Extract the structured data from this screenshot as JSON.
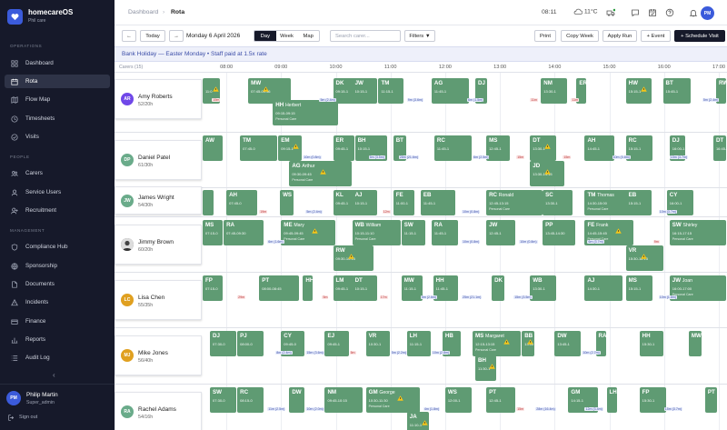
{
  "brand": {
    "title": "homecareOS",
    "subtitle": "Phil care"
  },
  "sidebar": {
    "sections": [
      "OPERATIONS",
      "PEOPLE",
      "MANAGEMENT"
    ],
    "items": [
      {
        "label": "Dashboard",
        "icon": "grid-icon"
      },
      {
        "label": "Rota",
        "icon": "calendar-icon",
        "active": true
      },
      {
        "label": "Flow Map",
        "icon": "map-icon"
      },
      {
        "label": "Timesheets",
        "icon": "clock-icon"
      },
      {
        "label": "Visits",
        "icon": "check-circle-icon"
      },
      {
        "label": "Carers",
        "icon": "users-icon"
      },
      {
        "label": "Service Users",
        "icon": "user-icon"
      },
      {
        "label": "Recruitment",
        "icon": "user-plus-icon"
      },
      {
        "label": "Compliance Hub",
        "icon": "shield-icon"
      },
      {
        "label": "Sponsorship",
        "icon": "globe-icon"
      },
      {
        "label": "Documents",
        "icon": "file-icon"
      },
      {
        "label": "Incidents",
        "icon": "alert-icon"
      },
      {
        "label": "Finance",
        "icon": "finance-icon"
      },
      {
        "label": "Reports",
        "icon": "bar-chart-icon"
      },
      {
        "label": "Audit Log",
        "icon": "list-icon"
      }
    ],
    "collapse": "‹",
    "user": {
      "initials": "PM",
      "name": "Philip Martin",
      "role": "Super_admin"
    },
    "signout": "Sign out"
  },
  "topbar": {
    "crumb1": "Dashboard",
    "sep": "›",
    "crumb2": "Rota",
    "time": "08:11",
    "weather": "11°C",
    "avatar": "PM"
  },
  "toolbar": {
    "prev": "←",
    "today": "Today",
    "next": "→",
    "date": "Monday 6 April 2026",
    "views": [
      "Day",
      "Week",
      "Map"
    ],
    "active_view": "Day",
    "search_placeholder": "Search carer...",
    "filters": "Filters ▼",
    "print": "Print",
    "copy_week": "Copy Week",
    "apply_run": "Apply Run",
    "add_event": "+ Event",
    "schedule": "+ Schedule Visit"
  },
  "banner": "Bank Holiday  —  Easter Monday  •  Staff paid at 1.5x rate",
  "grid": {
    "carers_label": "Carers (15)",
    "hours": [
      "08:00",
      "09:00",
      "10:00",
      "11:00",
      "12:00",
      "13:00",
      "14:00",
      "15:00",
      "16:00",
      "17:00"
    ],
    "start_hour": 7.55,
    "end_hour": 17.15
  },
  "carers": [
    {
      "name": "Amy Roberts",
      "hours": "52/20h",
      "initials": "AR",
      "color": "#7048e8",
      "shifts": [
        {
          "i": "",
          "s": 7.55,
          "e": 7.9,
          "w": 1,
          "t": "11:0"
        },
        {
          "i": "MW",
          "s": 8.4,
          "e": 9.2,
          "w": 1,
          "t": "07:45-09:36"
        },
        {
          "i": "DK",
          "s": 9.95,
          "e": 10.4,
          "t": "09:15-1"
        },
        {
          "i": "JW",
          "s": 10.3,
          "e": 10.78,
          "t": "10:15-1"
        },
        {
          "i": "TM",
          "s": 10.78,
          "e": 11.25,
          "t": "11:15-1"
        },
        {
          "i": "AG",
          "s": 11.75,
          "e": 12.45,
          "t": "11:45-1"
        },
        {
          "i": "DJ",
          "s": 12.55,
          "e": 12.78
        },
        {
          "i": "NM",
          "s": 13.75,
          "e": 14.25,
          "t": "13:30-1"
        },
        {
          "i": "ER",
          "s": 14.4,
          "e": 14.6
        },
        {
          "i": "HW",
          "s": 15.3,
          "e": 15.78,
          "w": 1,
          "t": "15:15-1"
        },
        {
          "i": "BT",
          "s": 15.98,
          "e": 16.5,
          "t": "15:45-1"
        },
        {
          "i": "RW",
          "s": 16.95,
          "e": 17.15
        },
        {
          "i": "HH",
          "n": "Herbert",
          "s": 8.85,
          "e": 10.05,
          "t": "09:15-09:15",
          "pc": "Personal Care",
          "l": 2
        }
      ],
      "gaps": [
        {
          "s": 7.74,
          "v": "19m",
          "c": "r"
        },
        {
          "s": 9.7,
          "v": "5m (2.4m)",
          "c": "b"
        },
        {
          "s": 11.3,
          "v": "9m (3.6m)",
          "c": "b"
        },
        {
          "s": 12.4,
          "v": "6m (1.5m)",
          "c": "b"
        },
        {
          "s": 13.55,
          "v": "11m",
          "c": "r"
        },
        {
          "s": 14.3,
          "v": "11m",
          "c": "r"
        },
        {
          "s": 16.7,
          "v": "5m (2.4m)",
          "c": "b"
        }
      ]
    },
    {
      "name": "Daniel Patel",
      "hours": "61/30h",
      "initials": "DP",
      "color": "#6aab8a",
      "shifts": [
        {
          "i": "AW",
          "s": 7.55,
          "e": 7.95
        },
        {
          "i": "TM",
          "s": 8.25,
          "e": 8.95,
          "t": "07:45-0"
        },
        {
          "i": "EM",
          "s": 8.95,
          "e": 9.4,
          "w": 1,
          "t": "09:15-1"
        },
        {
          "i": "ER",
          "s": 9.95,
          "e": 10.35,
          "t": "09:45-1"
        },
        {
          "i": "BH",
          "s": 10.35,
          "e": 10.95,
          "t": "10:15-1"
        },
        {
          "i": "BT",
          "s": 11.05,
          "e": 11.3
        },
        {
          "i": "RC",
          "s": 11.8,
          "e": 12.5,
          "t": "11:45-1"
        },
        {
          "i": "MS",
          "s": 12.75,
          "e": 13.2,
          "t": "12:45-1"
        },
        {
          "i": "DT",
          "s": 13.55,
          "e": 14.05,
          "w": 1,
          "t": "13:30-1"
        },
        {
          "i": "AH",
          "s": 14.55,
          "e": 15.1,
          "t": "14:45-1"
        },
        {
          "i": "RC",
          "s": 15.3,
          "e": 15.8,
          "t": "15:15-1"
        },
        {
          "i": "DJ",
          "s": 16.1,
          "e": 16.4,
          "t": "16:00-1"
        },
        {
          "i": "DT",
          "s": 16.9,
          "e": 17.15,
          "t": "16:45-1"
        },
        {
          "i": "AG",
          "n": "Arthur",
          "s": 9.15,
          "e": 10.3,
          "w": 1,
          "t": "09:30-09:45",
          "pc": "Personal Care",
          "l": 2
        },
        {
          "i": "JD",
          "s": 13.55,
          "e": 14.2,
          "w": 1,
          "t": "13:30-14:15",
          "l": 2
        }
      ],
      "gaps": [
        {
          "s": 9.4,
          "v": "10m (0.8m)",
          "c": "b"
        },
        {
          "s": 10.6,
          "v": "5m (3.5m)",
          "c": "b"
        },
        {
          "s": 11.15,
          "v": "28m (21.6m)",
          "c": "b"
        },
        {
          "s": 12.5,
          "v": "6m (2.5m)",
          "c": "b"
        },
        {
          "s": 13.3,
          "v": "15m",
          "c": "r"
        },
        {
          "s": 14.15,
          "v": "15m",
          "c": "r"
        },
        {
          "s": 15.05,
          "v": "10m (0.8m)",
          "c": "b"
        },
        {
          "s": 16.1,
          "v": "15m (3.7m)",
          "c": "b"
        }
      ]
    },
    {
      "name": "James Wright",
      "hours": "54/30h",
      "initials": "JW",
      "color": "#6aab8a",
      "shifts": [
        {
          "i": "",
          "s": 7.55,
          "e": 7.78
        },
        {
          "i": "AH",
          "s": 8.0,
          "e": 8.58,
          "t": "07:45-0"
        },
        {
          "i": "WS",
          "s": 8.98,
          "e": 9.25
        },
        {
          "i": "KL",
          "s": 9.95,
          "e": 10.4,
          "t": "09:45-1"
        },
        {
          "i": "AJ",
          "s": 10.3,
          "e": 10.78,
          "t": "10:15-1"
        },
        {
          "i": "FE",
          "s": 11.05,
          "e": 11.45,
          "t": "11:00-1"
        },
        {
          "i": "EB",
          "s": 11.55,
          "e": 12.2,
          "t": "11:45-1"
        },
        {
          "i": "RC",
          "n": "Ronald",
          "s": 12.75,
          "e": 13.8,
          "t": "12:45-13:15",
          "pc": "Personal Care"
        },
        {
          "i": "SC",
          "s": 13.78,
          "e": 14.35,
          "t": "13:30-1"
        },
        {
          "i": "TM",
          "n": "Thomas",
          "s": 14.55,
          "e": 15.4,
          "t": "14:30-15:00",
          "pc": "Personal Care"
        },
        {
          "i": "EB",
          "s": 15.3,
          "e": 15.78,
          "t": "15:15-1"
        },
        {
          "i": "CY",
          "s": 16.05,
          "e": 16.55,
          "t": "16:00-1"
        }
      ],
      "gaps": [
        {
          "s": 8.6,
          "v": "19m",
          "c": "r"
        },
        {
          "s": 9.45,
          "v": "5m (2.4m)",
          "c": "b"
        },
        {
          "s": 10.85,
          "v": "12m",
          "c": "r"
        },
        {
          "s": 12.3,
          "v": "10m (0.8m)",
          "c": "b"
        },
        {
          "s": 15.9,
          "v": "10m (3.7m)",
          "c": "b"
        }
      ]
    },
    {
      "name": "Jimmy Brown",
      "hours": "60/20h",
      "initials": "JB",
      "color": "#555",
      "photo": true,
      "shifts": [
        {
          "i": "MS",
          "s": 7.45,
          "e": 7.95,
          "t": "07:15-0"
        },
        {
          "i": "RA",
          "s": 7.95,
          "e": 8.7,
          "t": "07:45-09:30"
        },
        {
          "i": "ME",
          "n": "Mary",
          "s": 9.0,
          "e": 10.0,
          "w": 1,
          "t": "09:45-09:45",
          "pc": "Personal Care"
        },
        {
          "i": "WB",
          "n": "William",
          "s": 10.3,
          "e": 11.2,
          "t": "10:15-11:10",
          "pc": "Personal Care"
        },
        {
          "i": "SW",
          "s": 11.2,
          "e": 11.65,
          "t": "11:15-1"
        },
        {
          "i": "RA",
          "s": 11.75,
          "e": 12.25,
          "t": "11:45-1"
        },
        {
          "i": "JW",
          "s": 12.75,
          "e": 13.3,
          "t": "12:45-1"
        },
        {
          "i": "PP",
          "s": 13.78,
          "e": 14.4,
          "t": "13:45-14:30"
        },
        {
          "i": "FE",
          "n": "Frank",
          "s": 14.55,
          "e": 15.45,
          "w": 1,
          "t": "14:45-15:45",
          "pc": "Personal Care"
        },
        {
          "i": "SW",
          "n": "Shirley",
          "s": 16.1,
          "e": 17.15,
          "t": "16:15-17:15",
          "pc": "Personal Care"
        },
        {
          "i": "RW",
          "s": 9.95,
          "e": 10.7,
          "w": 1,
          "t": "09:30-10:15",
          "l": 2
        },
        {
          "i": "VR",
          "s": 15.3,
          "e": 16.0,
          "w": 1,
          "t": "15:30-16:15",
          "l": 2
        }
      ],
      "gaps": [
        {
          "s": 8.75,
          "v": "6m (1.6m)",
          "c": "b"
        },
        {
          "s": 12.3,
          "v": "10m (0.8m)",
          "c": "b"
        },
        {
          "s": 13.35,
          "v": "10m (0.8m)",
          "c": "b"
        },
        {
          "s": 14.6,
          "v": "6m (3.7m)",
          "c": "b"
        },
        {
          "s": 15.8,
          "v": "9m",
          "c": "r"
        }
      ]
    },
    {
      "name": "Lisa Chen",
      "hours": "55/35h",
      "initials": "LC",
      "color": "#e0a020",
      "shifts": [
        {
          "i": "FP",
          "s": 7.45,
          "e": 7.95,
          "t": "07:15-0"
        },
        {
          "i": "PT",
          "s": 8.6,
          "e": 9.35,
          "t": "08:00-08:45"
        },
        {
          "i": "HH",
          "s": 9.4,
          "e": 9.6
        },
        {
          "i": "LM",
          "s": 9.95,
          "e": 10.35,
          "t": "09:45-1"
        },
        {
          "i": "DT",
          "s": 10.3,
          "e": 10.78,
          "t": "10:15-1"
        },
        {
          "i": "MW",
          "s": 11.2,
          "e": 11.6,
          "t": "11:15-1"
        },
        {
          "i": "HH",
          "s": 11.78,
          "e": 12.25,
          "t": "11:45-1"
        },
        {
          "i": "DK",
          "s": 12.85,
          "e": 13.1
        },
        {
          "i": "WB",
          "s": 13.55,
          "e": 14.05,
          "t": "13:30-1"
        },
        {
          "i": "AJ",
          "s": 14.55,
          "e": 15.25,
          "t": "14:30-1"
        },
        {
          "i": "MS",
          "s": 15.3,
          "e": 15.8,
          "t": "15:15-1"
        },
        {
          "i": "JW",
          "n": "Joan",
          "s": 16.1,
          "e": 17.15,
          "t": "16:00-17:00",
          "pc": "Personal Care"
        }
      ],
      "gaps": [
        {
          "s": 8.2,
          "v": "29m",
          "c": "r"
        },
        {
          "s": 9.75,
          "v": "5m",
          "c": "r"
        },
        {
          "s": 10.8,
          "v": "17m",
          "c": "r"
        },
        {
          "s": 11.55,
          "v": "5m (2.6m)",
          "c": "b"
        },
        {
          "s": 12.3,
          "v": "25m (21.1m)",
          "c": "b"
        },
        {
          "s": 13.25,
          "v": "15m (3.5m)",
          "c": "b"
        },
        {
          "s": 15.9,
          "v": "10m (1.8m)",
          "c": "b"
        }
      ]
    },
    {
      "name": "Mike Jones",
      "hours": "56/40h",
      "initials": "MJ",
      "color": "#e0a020",
      "shifts": [
        {
          "i": "DJ",
          "s": 7.7,
          "e": 8.2,
          "t": "07:30-0"
        },
        {
          "i": "PJ",
          "s": 8.2,
          "e": 8.7,
          "t": "08:00-0"
        },
        {
          "i": "CY",
          "s": 9.0,
          "e": 9.45,
          "t": "09:45-0"
        },
        {
          "i": "EJ",
          "s": 9.8,
          "e": 10.25,
          "t": "09:45-1"
        },
        {
          "i": "VR",
          "s": 10.55,
          "e": 11.0,
          "t": "10:30-1"
        },
        {
          "i": "LH",
          "s": 11.3,
          "e": 11.75,
          "t": "11:15-1"
        },
        {
          "i": "HB",
          "s": 11.95,
          "e": 12.3
        },
        {
          "i": "MS",
          "n": "Margaret",
          "s": 12.5,
          "e": 13.4,
          "w": 1,
          "t": "12:15-13:15",
          "pc": "Personal Care"
        },
        {
          "i": "BB",
          "s": 13.4,
          "e": 13.65,
          "w": 1,
          "t": "13:00"
        },
        {
          "i": "DW",
          "s": 14.0,
          "e": 14.5,
          "t": "13:45-1"
        },
        {
          "i": "RA",
          "s": 14.75,
          "e": 14.95
        },
        {
          "i": "HH",
          "s": 15.55,
          "e": 16.0,
          "t": "15:30-1"
        },
        {
          "i": "MW",
          "s": 16.45,
          "e": 16.7
        },
        {
          "i": "BH",
          "s": 12.55,
          "e": 12.95,
          "w": 1,
          "t": "11:30-1",
          "l": 2
        }
      ],
      "gaps": [
        {
          "s": 8.9,
          "v": "8m (2.4m)",
          "c": "b"
        },
        {
          "s": 9.45,
          "v": "15m (3.6m)",
          "c": "b"
        },
        {
          "s": 10.25,
          "v": "5m",
          "c": "r"
        },
        {
          "s": 11.0,
          "v": "5m (2.2m)",
          "c": "b"
        },
        {
          "s": 11.75,
          "v": "10m (2.8m)",
          "c": "b"
        },
        {
          "s": 14.5,
          "v": "10m (2.7m)",
          "c": "b"
        }
      ]
    },
    {
      "name": "Rachel Adams",
      "hours": "54/16h",
      "initials": "RA",
      "color": "#6aab8a",
      "shifts": [
        {
          "i": "SW",
          "s": 7.7,
          "e": 8.2,
          "t": "07:30-0"
        },
        {
          "i": "RC",
          "s": 8.2,
          "e": 8.7,
          "t": "08:15-0"
        },
        {
          "i": "DW",
          "s": 9.15,
          "e": 9.45
        },
        {
          "i": "NM",
          "s": 9.8,
          "e": 10.5,
          "t": "09:45-10:15"
        },
        {
          "i": "GM",
          "n": "George",
          "s": 10.55,
          "e": 11.55,
          "w": 1,
          "t": "10:30-11:30",
          "pc": "Personal Care"
        },
        {
          "i": "WS",
          "s": 12.0,
          "e": 12.5,
          "t": "12:00-1"
        },
        {
          "i": "PT",
          "s": 12.75,
          "e": 13.3,
          "t": "12:45-1"
        },
        {
          "i": "GM",
          "s": 14.25,
          "e": 14.8,
          "t": "14:15-1"
        },
        {
          "i": "LH",
          "s": 14.95,
          "e": 15.15
        },
        {
          "i": "FP",
          "s": 15.55,
          "e": 16.05,
          "t": "15:30-1"
        },
        {
          "i": "PT",
          "s": 16.75,
          "e": 16.98
        },
        {
          "i": "JA",
          "s": 11.3,
          "e": 11.72,
          "w": 1,
          "t": "11:10-1",
          "l": 2
        }
      ],
      "gaps": [
        {
          "s": 8.75,
          "v": "11m (2.5m)",
          "c": "b"
        },
        {
          "s": 9.45,
          "v": "10m (2.0m)",
          "c": "b"
        },
        {
          "s": 11.6,
          "v": "4m (1.8m)",
          "c": "b"
        },
        {
          "s": 13.3,
          "v": "15m",
          "c": "r"
        },
        {
          "s": 13.65,
          "v": "28m (16.4m)",
          "c": "b"
        },
        {
          "s": 14.55,
          "v": "12m (3.4m)",
          "c": "b"
        },
        {
          "s": 16.0,
          "v": "15m (3.7m)",
          "c": "b"
        }
      ]
    }
  ]
}
